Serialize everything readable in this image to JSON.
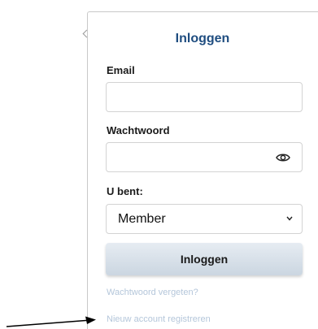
{
  "form": {
    "title": "Inloggen",
    "email_label": "Email",
    "email_value": "",
    "password_label": "Wachtwoord",
    "password_value": "",
    "role_label": "U bent:",
    "role_selected": "Member",
    "submit_label": "Inloggen",
    "forgot_link": "Wachtwoord vergeten?",
    "register_link": "Nieuw account registreren"
  },
  "icons": {
    "password_toggle": "eye-icon",
    "select_arrow": "chevron-down-icon",
    "annotation": "arrow-pointer"
  },
  "colors": {
    "title": "#1f4d80",
    "link": "#b4c6da",
    "button_top": "#e6ecf2",
    "button_bottom": "#cbd6e1"
  }
}
